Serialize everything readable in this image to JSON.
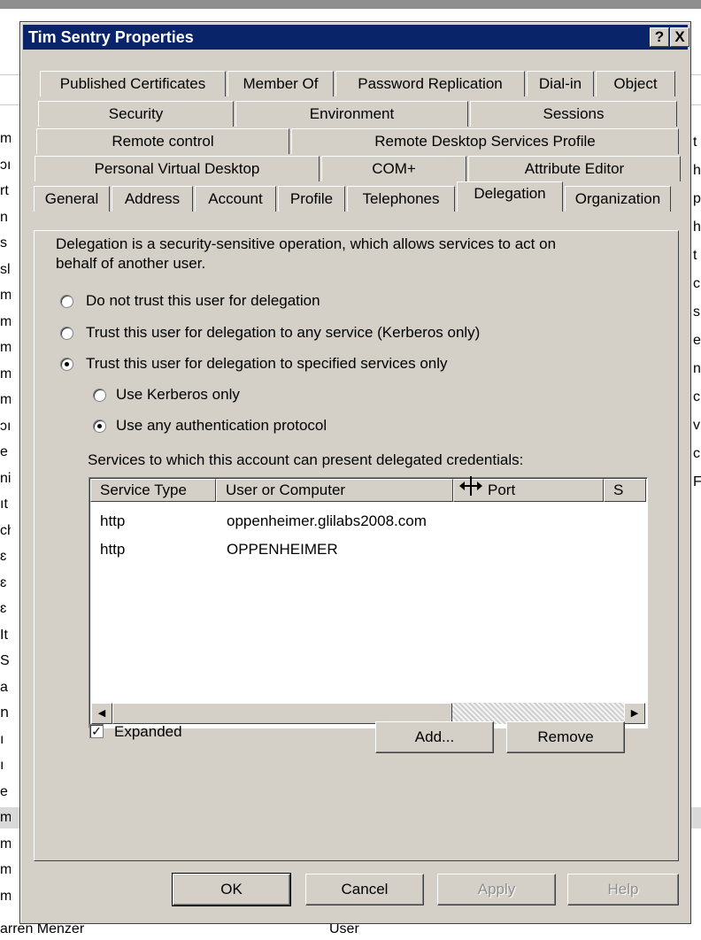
{
  "background": {
    "left_letters": [
      "m",
      "ɔı",
      "rt",
      "n",
      "s",
      "sl",
      "m",
      "m",
      "m",
      "m",
      "m",
      "ɔı",
      "e",
      "ni",
      "ıt",
      "ch",
      "ɛ",
      "ɛ",
      "ɛ",
      "It",
      "S",
      "a",
      "ո",
      "ı",
      "ı",
      "e",
      "m",
      "m",
      "m",
      "m"
    ],
    "right_letters": [
      "t",
      "h",
      "p",
      "h",
      "t",
      "c",
      "s",
      "e",
      "n",
      "c",
      "v",
      "c",
      "F"
    ],
    "bottom_name": "arren Menzer",
    "bottom_type": "User"
  },
  "dialog": {
    "title": "Tim Sentry Properties",
    "help_button": "?",
    "close_button": "X"
  },
  "tabs": {
    "row1": [
      "Published Certificates",
      "Member Of",
      "Password Replication",
      "Dial-in",
      "Object"
    ],
    "row2": [
      "Security",
      "Environment",
      "Sessions"
    ],
    "row3": [
      "Remote control",
      "Remote Desktop Services Profile"
    ],
    "row4": [
      "Personal Virtual Desktop",
      "COM+",
      "Attribute Editor"
    ],
    "row5": [
      "General",
      "Address",
      "Account",
      "Profile",
      "Telephones",
      "Delegation",
      "Organization"
    ],
    "active": "Delegation"
  },
  "delegation": {
    "description_line1": "Delegation is a security-sensitive operation, which allows services to act on",
    "description_line2": "behalf of another user.",
    "options": [
      {
        "label": "Do not trust this user for delegation",
        "selected": false
      },
      {
        "label": "Trust this user for delegation to any service (Kerberos only)",
        "selected": false
      },
      {
        "label": "Trust this user for delegation to specified services only",
        "selected": true
      }
    ],
    "sub_options": [
      {
        "label": "Use Kerberos only",
        "selected": false
      },
      {
        "label": "Use any authentication protocol",
        "selected": true
      }
    ],
    "services_label": "Services to which this account can present delegated credentials:",
    "columns": [
      "Service Type",
      "User or Computer",
      "Port",
      "S"
    ],
    "rows": [
      {
        "service_type": "http",
        "user_or_computer": "oppenheimer.glilabs2008.com"
      },
      {
        "service_type": "http",
        "user_or_computer": "OPPENHEIMER"
      }
    ],
    "expanded_label": "Expanded",
    "expanded_checked": true,
    "add_button": "Add...",
    "remove_button": "Remove"
  },
  "footer": {
    "ok": "OK",
    "cancel": "Cancel",
    "apply": "Apply",
    "help": "Help"
  }
}
